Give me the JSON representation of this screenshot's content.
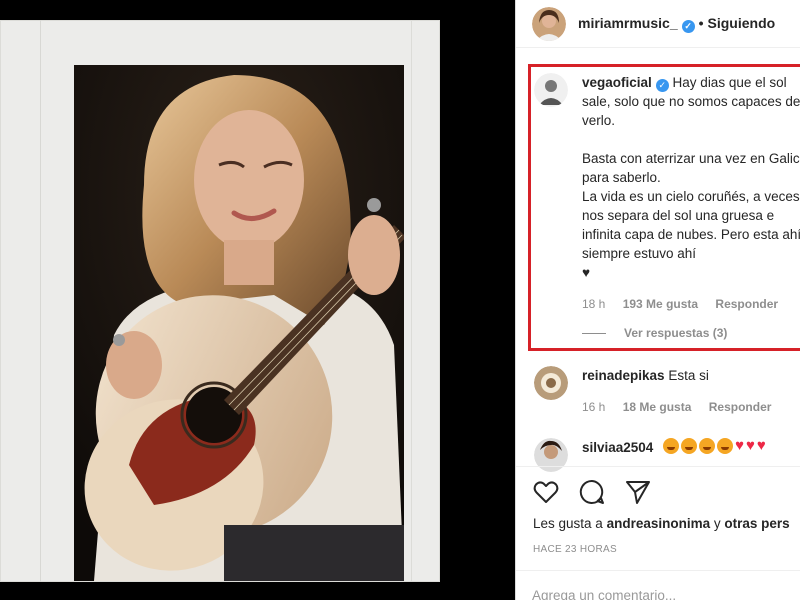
{
  "post": {
    "author": "miriamrmusic_",
    "separator": "•",
    "follow_label": "Siguiendo"
  },
  "comments": [
    {
      "user": "vegaoficial",
      "text_lines": [
        "Hay dias que el sol sale, solo que no somos capaces de verlo.",
        "Basta con aterrizar una vez en Galicia para saberlo.",
        "La vida es un cielo coruñés, a veces nos separa del sol una gruesa e infinita capa de nubes. Pero esta ahí, siempre estuvo ahí",
        "♥"
      ],
      "time": "18 h",
      "likes": "193 Me gusta",
      "reply_label": "Responder",
      "view_replies": "Ver respuestas (3)"
    },
    {
      "user": "reinadepikas",
      "text": "Esta si",
      "time": "16 h",
      "likes": "18 Me gusta",
      "reply_label": "Responder"
    },
    {
      "user": "silviaa2504"
    }
  ],
  "likes_line": {
    "prefix": "Les gusta a",
    "user": "andreasinonima",
    "joiner": "y",
    "others": "otras pers"
  },
  "timestamp": "HACE 23 HORAS",
  "add_comment_placeholder": "Agrega un comentario...",
  "icons": {
    "like": "heart-outline-icon",
    "comment": "speech-bubble-icon",
    "share": "paper-plane-icon",
    "verified": "verified-badge-icon"
  },
  "colors": {
    "highlight": "#d62128",
    "verified": "#3897f0",
    "muted": "#8e8e8e",
    "text": "#262626"
  }
}
